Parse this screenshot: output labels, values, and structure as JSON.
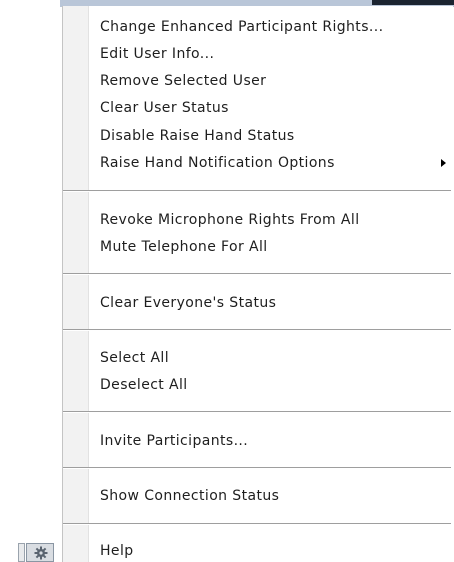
{
  "menu": {
    "items": [
      {
        "label": "Change Enhanced Participant Rights..."
      },
      {
        "label": "Edit User Info..."
      },
      {
        "label": "Remove Selected User"
      },
      {
        "label": "Clear User Status"
      },
      {
        "label": "Disable Raise Hand Status"
      },
      {
        "label": "Raise Hand Notification Options",
        "submenu": true
      },
      {
        "label": "Revoke Microphone Rights From All"
      },
      {
        "label": "Mute Telephone For All"
      },
      {
        "label": "Clear Everyone's Status"
      },
      {
        "label": "Select All"
      },
      {
        "label": "Deselect All"
      },
      {
        "label": "Invite Participants..."
      },
      {
        "label": "Show Connection Status"
      },
      {
        "label": "Help"
      }
    ]
  },
  "icons": {
    "submenu_arrow": "triangle-right-icon",
    "options_button": "gear-icon"
  },
  "colors": {
    "menu_text": "#1e1e1e",
    "separator": "#9e9e9e",
    "gutter": "#f2f2f2"
  }
}
